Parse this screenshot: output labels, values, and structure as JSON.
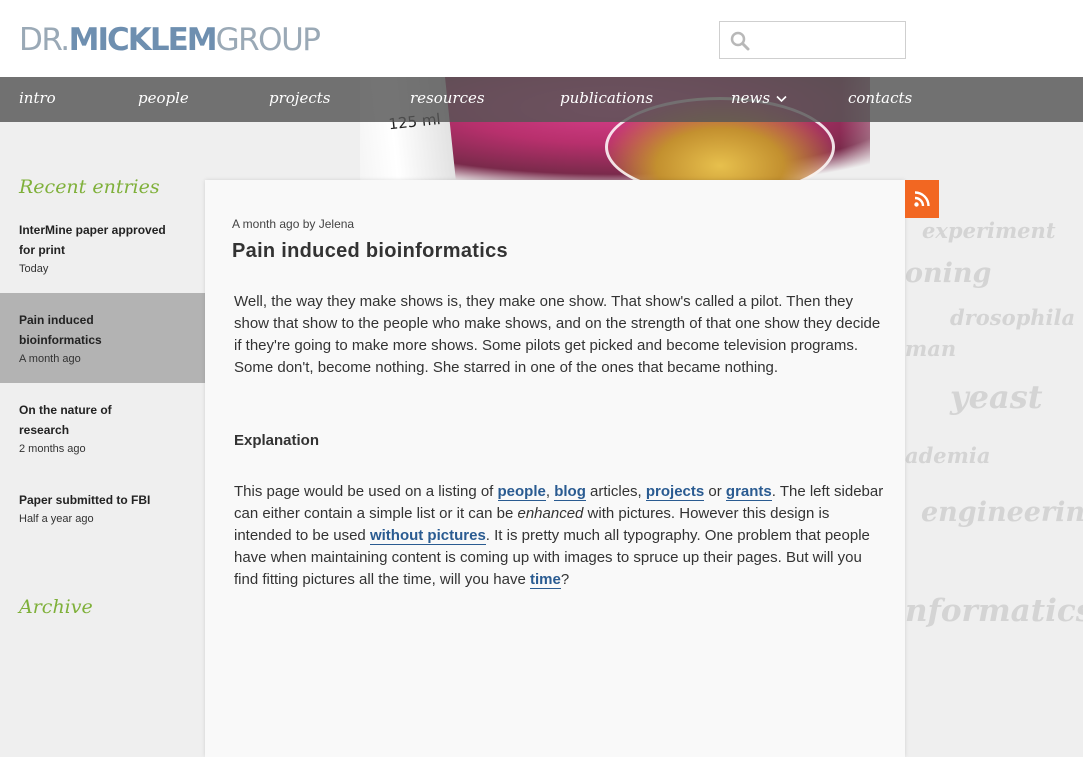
{
  "logo": {
    "dr": "DR.",
    "name": "MICKLEM",
    "group": "GROUP"
  },
  "search": {
    "placeholder": "",
    "value": ""
  },
  "nav": {
    "items": [
      {
        "label": "intro"
      },
      {
        "label": "people"
      },
      {
        "label": "projects"
      },
      {
        "label": "resources"
      },
      {
        "label": "publications"
      },
      {
        "label": "news"
      },
      {
        "label": "contacts"
      }
    ]
  },
  "hero": {
    "flask_mark": "125 ml"
  },
  "tags": [
    "experiment",
    "oning",
    "drosophila",
    "man",
    "yeast",
    "ademia",
    "engineering",
    "nformatics"
  ],
  "sidebar": {
    "recent_title": "Recent entries",
    "entries": [
      {
        "title": "InterMine paper approved for print",
        "date": "Today"
      },
      {
        "title": "Pain induced bioinformatics",
        "date": "A month ago"
      },
      {
        "title": "On the nature of research",
        "date": "2 months ago"
      },
      {
        "title": "Paper submitted to FBI",
        "date": "Half a year ago"
      }
    ],
    "archive_title": "Archive"
  },
  "post": {
    "meta": "A month ago by Jelena",
    "title": "Pain induced bioinformatics",
    "paragraph1": "Well, the way they make shows is, they make one show. That show's called a pilot. Then they show that show to the people who make shows, and on the strength of that one show they decide if they're going to make more shows. Some pilots get picked and become television programs. Some don't, become nothing. She starred in one of the ones that became nothing.",
    "heading": "Explanation",
    "p2": {
      "t1": "This page would be used on a listing of ",
      "l_people": "people",
      "t2": ", ",
      "l_blog": "blog",
      "t3": " articles, ",
      "l_projects": "projects",
      "t4": " or ",
      "l_grants": "grants",
      "t5": ". The left sidebar can either contain a simple list or it can be ",
      "em": "enhanced",
      "t6": " with pictures. However this design is intended to be used ",
      "l_without": "without pictures",
      "t7": ". It is pretty much all typography. One problem that people have when maintaining content is coming up with images to spruce up their pages. But will you find fitting pictures all the time, will you have ",
      "l_time": "time",
      "t8": "?"
    }
  },
  "colors": {
    "accent_green": "#7fb03a",
    "link_blue": "#2a5b91",
    "rss_orange": "#f26722",
    "nav_bg": "#555555"
  }
}
